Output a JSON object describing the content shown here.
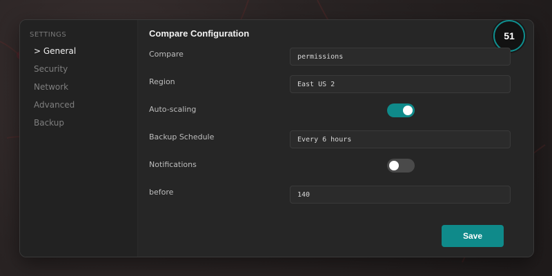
{
  "sidebar": {
    "heading": "SETTINGS",
    "items": [
      {
        "label": "> General"
      },
      {
        "label": "Security"
      },
      {
        "label": "Network"
      },
      {
        "label": "Advanced"
      },
      {
        "label": "Backup"
      }
    ]
  },
  "main": {
    "title": "Compare Configuration",
    "score_badge": "51",
    "fields": {
      "compare": {
        "label": "Compare",
        "value": "permissions"
      },
      "region": {
        "label": "Region",
        "value": "East US 2"
      },
      "auto_scaling": {
        "label": "Auto-scaling",
        "enabled": true
      },
      "backup_schedule": {
        "label": "Backup Schedule",
        "value": "Every 6 hours"
      },
      "notifications": {
        "label": "Notifications",
        "enabled": false
      },
      "before": {
        "label": "before",
        "value": "140"
      }
    },
    "save_label": "Save"
  },
  "colors": {
    "accent": "#0f8a8a",
    "panel": "#262626",
    "sidebar": "#222222"
  }
}
